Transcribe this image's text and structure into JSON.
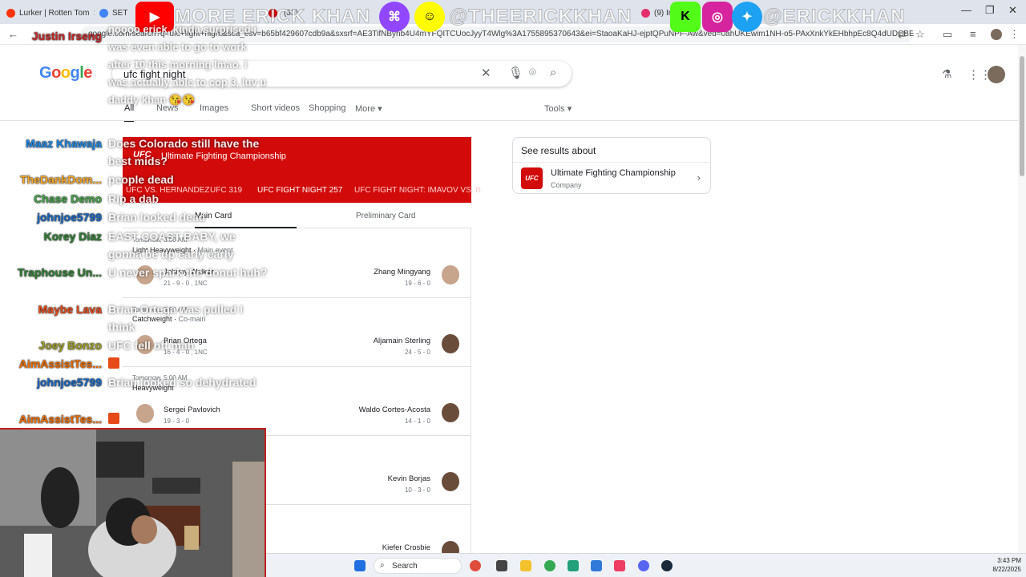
{
  "browser": {
    "tabs": [
      {
        "title": "Lurker | Rotten Tom",
        "color": "#fa320a"
      },
      {
        "title": "SET",
        "color": "#4285f4"
      },
      {
        "title": "",
        "color": "#777"
      },
      {
        "title": "",
        "color": "#cc0000"
      },
      {
        "title": "(53)",
        "color": "#ff0000"
      },
      {
        "title": "",
        "color": "#777"
      },
      {
        "title": "(9) In",
        "color": "#e1306c"
      },
      {
        "title": "",
        "color": "#777"
      }
    ],
    "url": "google.com/search?q=ufc+fight+night&sca_esv=b65bf429607cdb9a&sxsrf=AE3TifNBynb4U4mYFQITCUocJyyT4Wlg%3A1755895370643&ei=StaoaKaHJ-ejptQPuNPF-Aw&ved=0ahUKEwim1NH-o5-PAxXnkYkEHbhpEc8Q4dUDCBE&uact=5&oq="
  },
  "google": {
    "logo": "Google",
    "query": "ufc fight night",
    "tabs": [
      "All",
      "News",
      "Images",
      "Short videos",
      "Shopping",
      "More"
    ],
    "tools": "Tools"
  },
  "ufc_card": {
    "logo": "UFC",
    "name": "Ultimate Fighting Championship",
    "event_tabs": [
      "UFC VS. HERNANDEZ",
      "UFC 319",
      "UFC FIGHT NIGHT 257",
      "UFC FIGHT NIGHT: IMAVOV VS. B"
    ],
    "card_tabs": [
      "Main Card",
      "Preliminary Card"
    ],
    "fights": [
      {
        "time": "Tomorrow, 3:00 AM",
        "division": "Light Heavyweight",
        "event": "Main event",
        "left_name": "Johnny Walker",
        "left_record": "21 - 9 - 0 , 1NC",
        "right_name": "Zhang Mingyang",
        "right_record": "19 - 6 - 0"
      },
      {
        "time": "Tomorrow, 5:00 AM",
        "division": "Catchweight",
        "event": "Co-main",
        "left_name": "Brian Ortega",
        "left_record": "16 - 4 - 0 , 1NC",
        "right_name": "Aljamain Sterling",
        "right_record": "24 - 5 - 0"
      },
      {
        "time": "Tomorrow, 5:00 AM",
        "division": "Heavyweight",
        "event": "",
        "left_name": "Sergei Pavlovich",
        "left_record": "19 - 3 - 0",
        "right_name": "Waldo Cortes-Acosta",
        "right_record": "14 - 1 - 0"
      },
      {
        "time": "",
        "division": "",
        "event": "",
        "left_name": "",
        "left_record": "",
        "right_name": "Kevin Borjas",
        "right_record": "10 - 3 - 0"
      },
      {
        "time": "",
        "division": "",
        "event": "",
        "left_name": "",
        "left_record": "",
        "right_name": "Kiefer Crosbie",
        "right_record": ""
      }
    ]
  },
  "knowledge_panel": {
    "title": "See results about",
    "name": "Ultimate Fighting Championship",
    "subtitle": "Company",
    "logo": "UFC"
  },
  "overlay": {
    "banner": "MORE ERICK KHAN",
    "handle": "@THEERICKKHAN",
    "handle2": "@ERICKKHAN"
  },
  "chat": [
    {
      "name": "Justin Irseng",
      "color": "#c62828",
      "msg": "noooo erick, kinda surprised i was even able to go to work after 10 this morning lmao. i was actually able to cop 3, luv u daddy khan 😘😘"
    },
    {
      "name": "Maaz Khawaja",
      "color": "#1e88e5",
      "msg": "Does Colorado still have the best mids?"
    },
    {
      "name": "TheDankDom...",
      "color": "#f9a825",
      "msg": "people dead"
    },
    {
      "name": "Chase Demo",
      "color": "#43a047",
      "msg": "Rip a dab"
    },
    {
      "name": "johnjoe5799",
      "color": "#1565c0",
      "msg": "Brian looked dead"
    },
    {
      "name": "Korey Diaz",
      "color": "#2e7d32",
      "msg": "EAST COAST BABY, we gonna be up early early"
    },
    {
      "name": "Traphouse Un...",
      "color": "#2e7d32",
      "msg": "U never spark the donut huh?"
    },
    {
      "name": "Maybe Lava",
      "color": "#e64a19",
      "msg": "Brian Ortega was pulled I think"
    },
    {
      "name": "Joey Bonzo",
      "color": "#9e9d24",
      "msg": "UFC fell off man"
    },
    {
      "name": "AimAssistTes...",
      "color": "#ef6c00",
      "msg": ""
    },
    {
      "name": "johnjoe5799",
      "color": "#1565c0",
      "msg": "Brian looked so dehydrated"
    },
    {
      "name": "AimAssistTes...",
      "color": "#ef6c00",
      "msg": ""
    }
  ],
  "taskbar": {
    "search": "Search",
    "time": "3:43 PM",
    "date": "8/22/2025"
  }
}
